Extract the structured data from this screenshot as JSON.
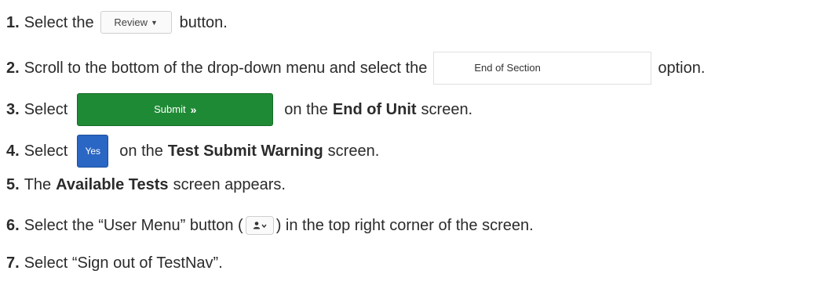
{
  "steps": [
    {
      "num": "1.",
      "pre": "Select the",
      "post": "button."
    },
    {
      "num": "2.",
      "pre": "Scroll to the bottom of the drop-down menu and select the",
      "post": "option."
    },
    {
      "num": "3.",
      "pre": "Select",
      "post_a": "on the",
      "bold": "End of Unit",
      "post_b": "screen."
    },
    {
      "num": "4.",
      "pre": "Select",
      "post_a": "on the",
      "bold": "Test Submit Warning",
      "post_b": "screen."
    },
    {
      "num": "5.",
      "pre": "The",
      "bold": "Available Tests",
      "post": "screen appears."
    },
    {
      "num": "6.",
      "pre": "Select the “User Menu” button (",
      "post": ") in the top right corner of the screen."
    },
    {
      "num": "7.",
      "text": "Select “Sign out of TestNav”."
    }
  ],
  "buttons": {
    "review_label": "Review",
    "end_of_section_label": "End of Section",
    "submit_label": "Submit",
    "yes_label": "Yes"
  },
  "colors": {
    "submit": "#1f8a35",
    "yes": "#2a66c4"
  },
  "icons": [
    "caret-down-icon",
    "double-chevron-right-icon",
    "user-icon"
  ]
}
